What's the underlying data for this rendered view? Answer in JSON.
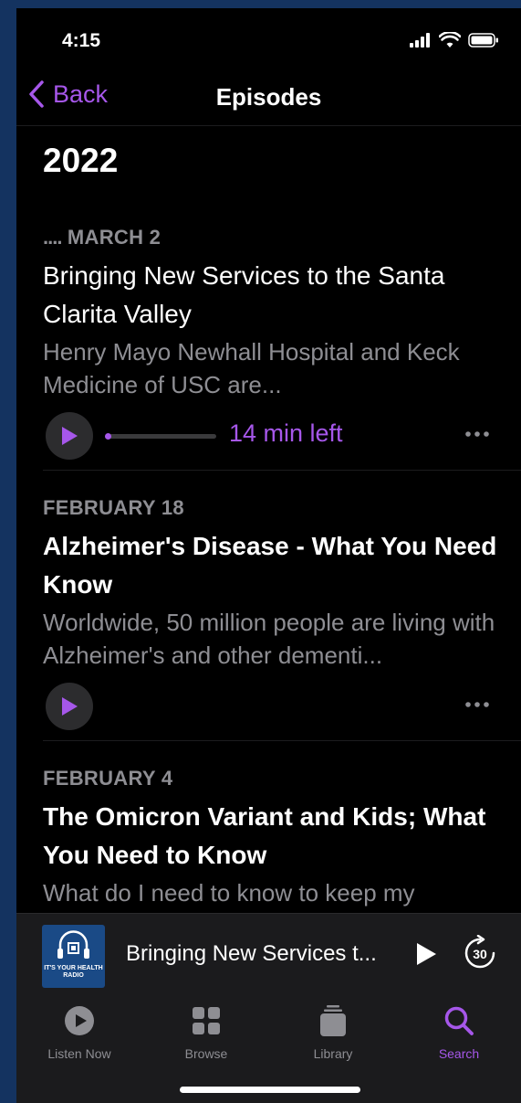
{
  "status_bar": {
    "time": "4:15"
  },
  "nav": {
    "back_label": "Back",
    "title": "Episodes"
  },
  "section": {
    "year": "2022"
  },
  "episodes": [
    {
      "date": "MARCH 2",
      "title": "Bringing New Services to the Santa Clarita Valley",
      "description": "Henry Mayo Newhall Hospital and Keck Medicine of USC are...",
      "time_left": "14 min left",
      "progress": 0.03
    },
    {
      "date": "FEBRUARY 18",
      "title": "Alzheimer's Disease - What You Need Know",
      "description": "Worldwide, 50 million people are living with Alzheimer's and other dementi..."
    },
    {
      "date": "FEBRUARY 4",
      "title": "The Omicron Variant and Kids; What You Need to Know",
      "description": "What do I need to know to keep my"
    }
  ],
  "mini_player": {
    "title": "Bringing New Services t...",
    "artwork_text": "IT'S YOUR HEALTH RADIO",
    "skip_seconds": "30"
  },
  "tabs": [
    {
      "label": "Listen Now",
      "icon": "play-circle-icon"
    },
    {
      "label": "Browse",
      "icon": "grid-icon"
    },
    {
      "label": "Library",
      "icon": "library-stack-icon"
    },
    {
      "label": "Search",
      "icon": "search-icon",
      "active": true
    }
  ],
  "colors": {
    "accent": "#a657ea",
    "background": "#000000",
    "frame": "#143360",
    "secondary_text": "#8e8e93"
  }
}
